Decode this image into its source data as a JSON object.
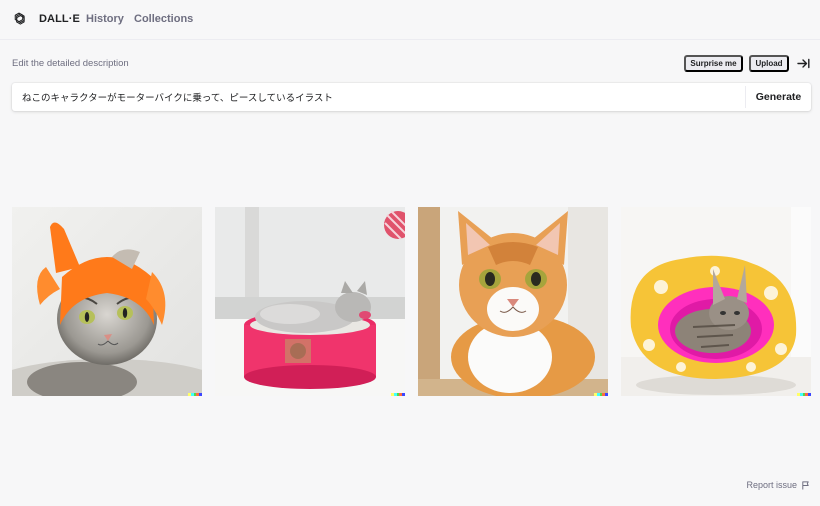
{
  "header": {
    "brand": "DALL·E",
    "nav": [
      "History",
      "Collections"
    ]
  },
  "prompt": {
    "label": "Edit the detailed description",
    "value": "ねこのキャラクターがモーターバイクに乗って、ピースしているイラスト",
    "surprise_label": "Surprise me",
    "upload_label": "Upload",
    "generate_label": "Generate"
  },
  "results": [
    {
      "name": "result-image-1",
      "icon": "cat-orange-hat"
    },
    {
      "name": "result-image-2",
      "icon": "kitten-in-pink-bowl"
    },
    {
      "name": "result-image-3",
      "icon": "orange-white-cat"
    },
    {
      "name": "result-image-4",
      "icon": "cat-in-yellow-bed"
    }
  ],
  "signature_colors": [
    "#ffff66",
    "#42ffff",
    "#51da4c",
    "#ff6e3c",
    "#3c46ff"
  ],
  "footer": {
    "report_label": "Report issue"
  },
  "colors": {
    "background": "#f7f7f8",
    "text": "#202123",
    "muted": "#6e6e80",
    "chip": "#ececf1"
  }
}
